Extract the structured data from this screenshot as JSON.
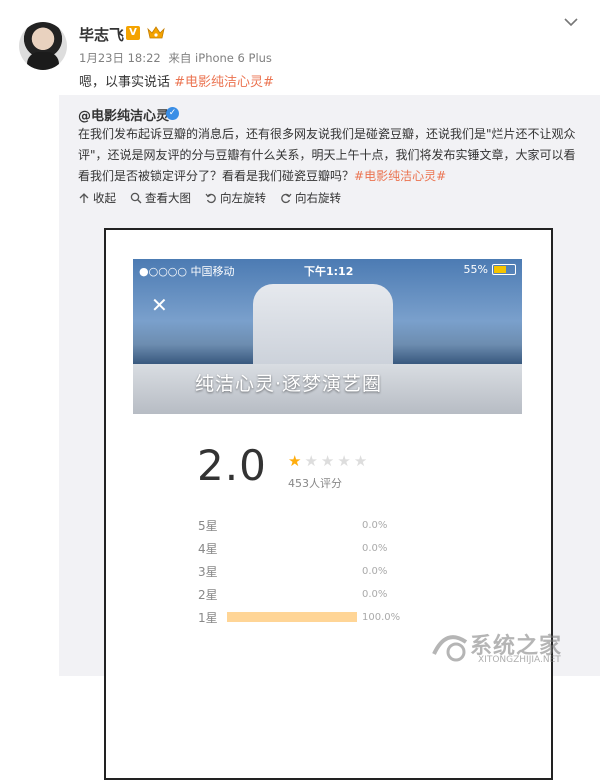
{
  "post": {
    "username": "毕志飞",
    "verified_badge": "V",
    "crown_icon": "crown-icon",
    "meta": {
      "date": "1月23日 18:22",
      "source": "来自 iPhone 6 Plus"
    },
    "text": "嗯，以事实说话",
    "hashtag": "#电影纯洁心灵#"
  },
  "repost": {
    "username": "@电影纯洁心灵",
    "verified_badge": "✓",
    "text_lines": [
      "在我们发布起诉豆瓣的消息后，还有很多网友说我们是碰瓷豆瓣，还说我们是\"烂片还不让观众",
      "评\"，还说是网友评的分与豆瓣有什么关系，明天上午十点，我们将发布实锤文章，大家可以看",
      "看我们是否被锁定评分了？看看是我们碰瓷豆瓣吗？"
    ],
    "hashtag": "#电影纯洁心灵#",
    "actions": [
      {
        "icon": "collapse-icon",
        "label": "收起"
      },
      {
        "icon": "zoom-icon",
        "label": "查看大图"
      },
      {
        "icon": "rotate-left-icon",
        "label": "向左旋转"
      },
      {
        "icon": "rotate-right-icon",
        "label": "向右旋转"
      }
    ]
  },
  "screenshot": {
    "status": {
      "carrier": "●○○○○ 中国移动",
      "time": "下午1:12",
      "battery": "55%"
    },
    "hero_title": "纯洁心灵·逐梦演艺圈",
    "rating": {
      "score": "2.0",
      "stars_filled": 1,
      "stars_total": 5,
      "count_label": "453人评分",
      "distribution": [
        {
          "label": "5星",
          "fraction": 0.0,
          "pct": "0.0%"
        },
        {
          "label": "4星",
          "fraction": 0.0,
          "pct": "0.0%"
        },
        {
          "label": "3星",
          "fraction": 0.0,
          "pct": "0.0%"
        },
        {
          "label": "2星",
          "fraction": 0.0,
          "pct": "0.0%"
        },
        {
          "label": "1星",
          "fraction": 1.0,
          "pct": "100.0%"
        }
      ]
    }
  },
  "watermark": {
    "text": "系统之家",
    "sub": "XITONGZHIJIA.NET"
  },
  "colors": {
    "hashtag": "#eb7350",
    "star": "#ffad0d",
    "bar": "#ffd596",
    "vip": "#f4a300"
  }
}
